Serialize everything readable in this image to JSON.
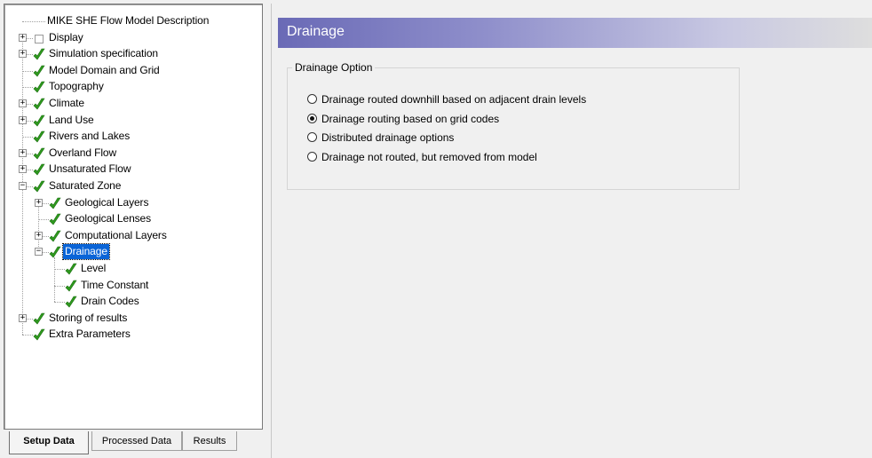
{
  "tree": {
    "items": [
      {
        "label": "MIKE SHE Flow Model Description",
        "level": 0,
        "expander": "none",
        "icon": "none"
      },
      {
        "label": "Display",
        "level": 0,
        "expander": "plus",
        "icon": "empty-checkbox"
      },
      {
        "label": "Simulation specification",
        "level": 0,
        "expander": "plus",
        "icon": "checkmark"
      },
      {
        "label": "Model Domain and Grid",
        "level": 0,
        "expander": "none",
        "icon": "checkmark"
      },
      {
        "label": "Topography",
        "level": 0,
        "expander": "none",
        "icon": "checkmark"
      },
      {
        "label": "Climate",
        "level": 0,
        "expander": "plus",
        "icon": "checkmark"
      },
      {
        "label": "Land Use",
        "level": 0,
        "expander": "plus",
        "icon": "checkmark"
      },
      {
        "label": "Rivers and Lakes",
        "level": 0,
        "expander": "none",
        "icon": "checkmark"
      },
      {
        "label": "Overland Flow",
        "level": 0,
        "expander": "plus",
        "icon": "checkmark"
      },
      {
        "label": "Unsaturated Flow",
        "level": 0,
        "expander": "plus",
        "icon": "checkmark"
      },
      {
        "label": "Saturated Zone",
        "level": 0,
        "expander": "minus",
        "icon": "checkmark"
      },
      {
        "label": "Geological Layers",
        "level": 1,
        "expander": "plus",
        "icon": "checkmark"
      },
      {
        "label": "Geological Lenses",
        "level": 1,
        "expander": "none",
        "icon": "checkmark"
      },
      {
        "label": "Computational Layers",
        "level": 1,
        "expander": "plus",
        "icon": "checkmark"
      },
      {
        "label": "Drainage",
        "level": 1,
        "expander": "minus",
        "icon": "checkmark",
        "selected": true
      },
      {
        "label": "Level",
        "level": 2,
        "expander": "none",
        "icon": "checkmark"
      },
      {
        "label": "Time Constant",
        "level": 2,
        "expander": "none",
        "icon": "checkmark"
      },
      {
        "label": "Drain Codes",
        "level": 2,
        "expander": "none",
        "icon": "checkmark"
      },
      {
        "label": "Storing of results",
        "level": 0,
        "expander": "plus",
        "icon": "checkmark"
      },
      {
        "label": "Extra Parameters",
        "level": 0,
        "expander": "none",
        "icon": "checkmark"
      }
    ]
  },
  "tabs": [
    {
      "label": "Setup Data",
      "active": true
    },
    {
      "label": "Processed Data",
      "active": false
    },
    {
      "label": "Results",
      "active": false
    }
  ],
  "panel": {
    "title": "Drainage",
    "group_label": "Drainage Option",
    "options": [
      {
        "label": "Drainage routed downhill based on adjacent drain levels",
        "selected": false
      },
      {
        "label": "Drainage routing based on grid codes",
        "selected": true
      },
      {
        "label": "Distributed drainage options",
        "selected": false
      },
      {
        "label": "Drainage not routed, but removed from model",
        "selected": false
      }
    ]
  },
  "colors": {
    "check_green": "#2e9a1e",
    "selection_blue": "#0a64d7",
    "title_gradient_start": "#6a6ab6"
  }
}
